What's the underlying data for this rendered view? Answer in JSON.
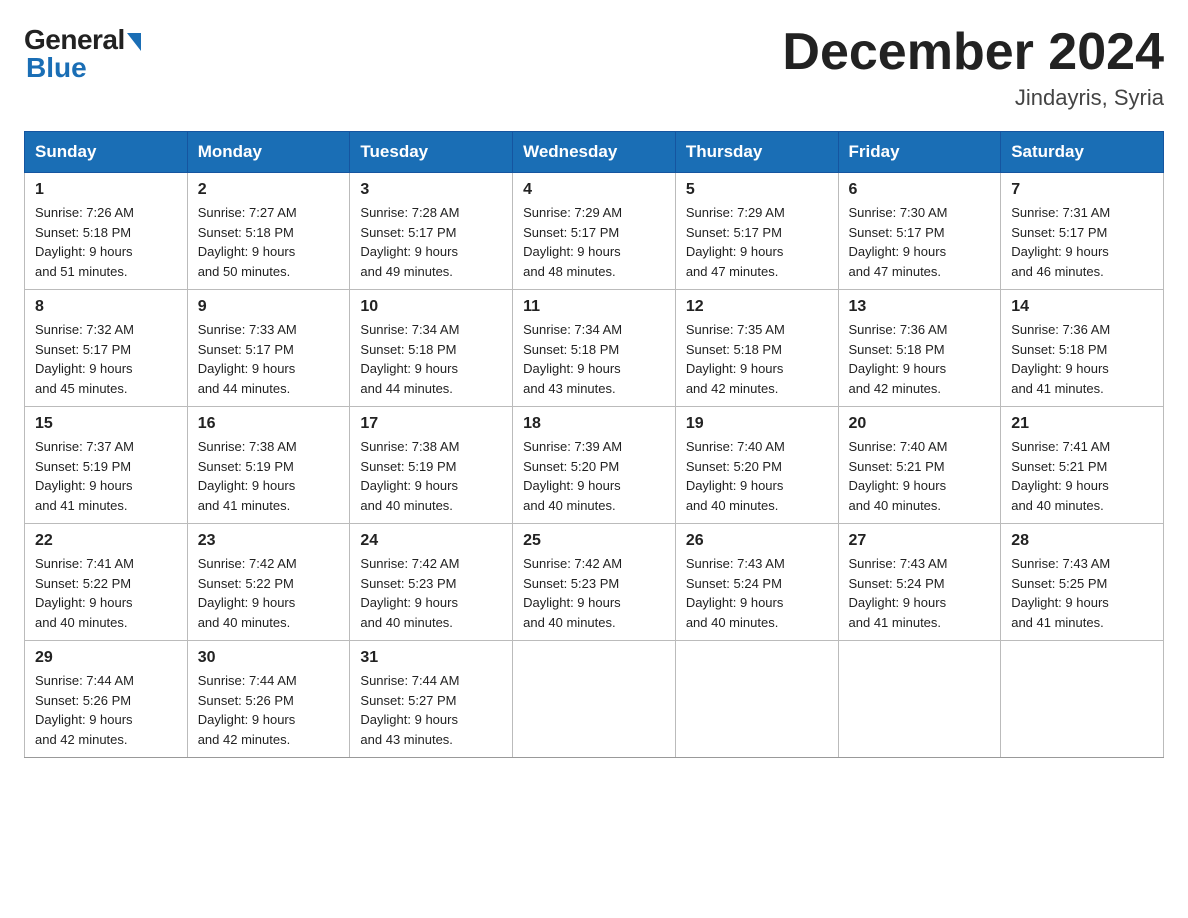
{
  "header": {
    "logo_general": "General",
    "logo_blue": "Blue",
    "month_title": "December 2024",
    "location": "Jindayris, Syria"
  },
  "days_of_week": [
    "Sunday",
    "Monday",
    "Tuesday",
    "Wednesday",
    "Thursday",
    "Friday",
    "Saturday"
  ],
  "weeks": [
    [
      {
        "day": "1",
        "sunrise": "7:26 AM",
        "sunset": "5:18 PM",
        "daylight": "9 hours and 51 minutes."
      },
      {
        "day": "2",
        "sunrise": "7:27 AM",
        "sunset": "5:18 PM",
        "daylight": "9 hours and 50 minutes."
      },
      {
        "day": "3",
        "sunrise": "7:28 AM",
        "sunset": "5:17 PM",
        "daylight": "9 hours and 49 minutes."
      },
      {
        "day": "4",
        "sunrise": "7:29 AM",
        "sunset": "5:17 PM",
        "daylight": "9 hours and 48 minutes."
      },
      {
        "day": "5",
        "sunrise": "7:29 AM",
        "sunset": "5:17 PM",
        "daylight": "9 hours and 47 minutes."
      },
      {
        "day": "6",
        "sunrise": "7:30 AM",
        "sunset": "5:17 PM",
        "daylight": "9 hours and 47 minutes."
      },
      {
        "day": "7",
        "sunrise": "7:31 AM",
        "sunset": "5:17 PM",
        "daylight": "9 hours and 46 minutes."
      }
    ],
    [
      {
        "day": "8",
        "sunrise": "7:32 AM",
        "sunset": "5:17 PM",
        "daylight": "9 hours and 45 minutes."
      },
      {
        "day": "9",
        "sunrise": "7:33 AM",
        "sunset": "5:17 PM",
        "daylight": "9 hours and 44 minutes."
      },
      {
        "day": "10",
        "sunrise": "7:34 AM",
        "sunset": "5:18 PM",
        "daylight": "9 hours and 44 minutes."
      },
      {
        "day": "11",
        "sunrise": "7:34 AM",
        "sunset": "5:18 PM",
        "daylight": "9 hours and 43 minutes."
      },
      {
        "day": "12",
        "sunrise": "7:35 AM",
        "sunset": "5:18 PM",
        "daylight": "9 hours and 42 minutes."
      },
      {
        "day": "13",
        "sunrise": "7:36 AM",
        "sunset": "5:18 PM",
        "daylight": "9 hours and 42 minutes."
      },
      {
        "day": "14",
        "sunrise": "7:36 AM",
        "sunset": "5:18 PM",
        "daylight": "9 hours and 41 minutes."
      }
    ],
    [
      {
        "day": "15",
        "sunrise": "7:37 AM",
        "sunset": "5:19 PM",
        "daylight": "9 hours and 41 minutes."
      },
      {
        "day": "16",
        "sunrise": "7:38 AM",
        "sunset": "5:19 PM",
        "daylight": "9 hours and 41 minutes."
      },
      {
        "day": "17",
        "sunrise": "7:38 AM",
        "sunset": "5:19 PM",
        "daylight": "9 hours and 40 minutes."
      },
      {
        "day": "18",
        "sunrise": "7:39 AM",
        "sunset": "5:20 PM",
        "daylight": "9 hours and 40 minutes."
      },
      {
        "day": "19",
        "sunrise": "7:40 AM",
        "sunset": "5:20 PM",
        "daylight": "9 hours and 40 minutes."
      },
      {
        "day": "20",
        "sunrise": "7:40 AM",
        "sunset": "5:21 PM",
        "daylight": "9 hours and 40 minutes."
      },
      {
        "day": "21",
        "sunrise": "7:41 AM",
        "sunset": "5:21 PM",
        "daylight": "9 hours and 40 minutes."
      }
    ],
    [
      {
        "day": "22",
        "sunrise": "7:41 AM",
        "sunset": "5:22 PM",
        "daylight": "9 hours and 40 minutes."
      },
      {
        "day": "23",
        "sunrise": "7:42 AM",
        "sunset": "5:22 PM",
        "daylight": "9 hours and 40 minutes."
      },
      {
        "day": "24",
        "sunrise": "7:42 AM",
        "sunset": "5:23 PM",
        "daylight": "9 hours and 40 minutes."
      },
      {
        "day": "25",
        "sunrise": "7:42 AM",
        "sunset": "5:23 PM",
        "daylight": "9 hours and 40 minutes."
      },
      {
        "day": "26",
        "sunrise": "7:43 AM",
        "sunset": "5:24 PM",
        "daylight": "9 hours and 40 minutes."
      },
      {
        "day": "27",
        "sunrise": "7:43 AM",
        "sunset": "5:24 PM",
        "daylight": "9 hours and 41 minutes."
      },
      {
        "day": "28",
        "sunrise": "7:43 AM",
        "sunset": "5:25 PM",
        "daylight": "9 hours and 41 minutes."
      }
    ],
    [
      {
        "day": "29",
        "sunrise": "7:44 AM",
        "sunset": "5:26 PM",
        "daylight": "9 hours and 42 minutes."
      },
      {
        "day": "30",
        "sunrise": "7:44 AM",
        "sunset": "5:26 PM",
        "daylight": "9 hours and 42 minutes."
      },
      {
        "day": "31",
        "sunrise": "7:44 AM",
        "sunset": "5:27 PM",
        "daylight": "9 hours and 43 minutes."
      },
      null,
      null,
      null,
      null
    ]
  ]
}
